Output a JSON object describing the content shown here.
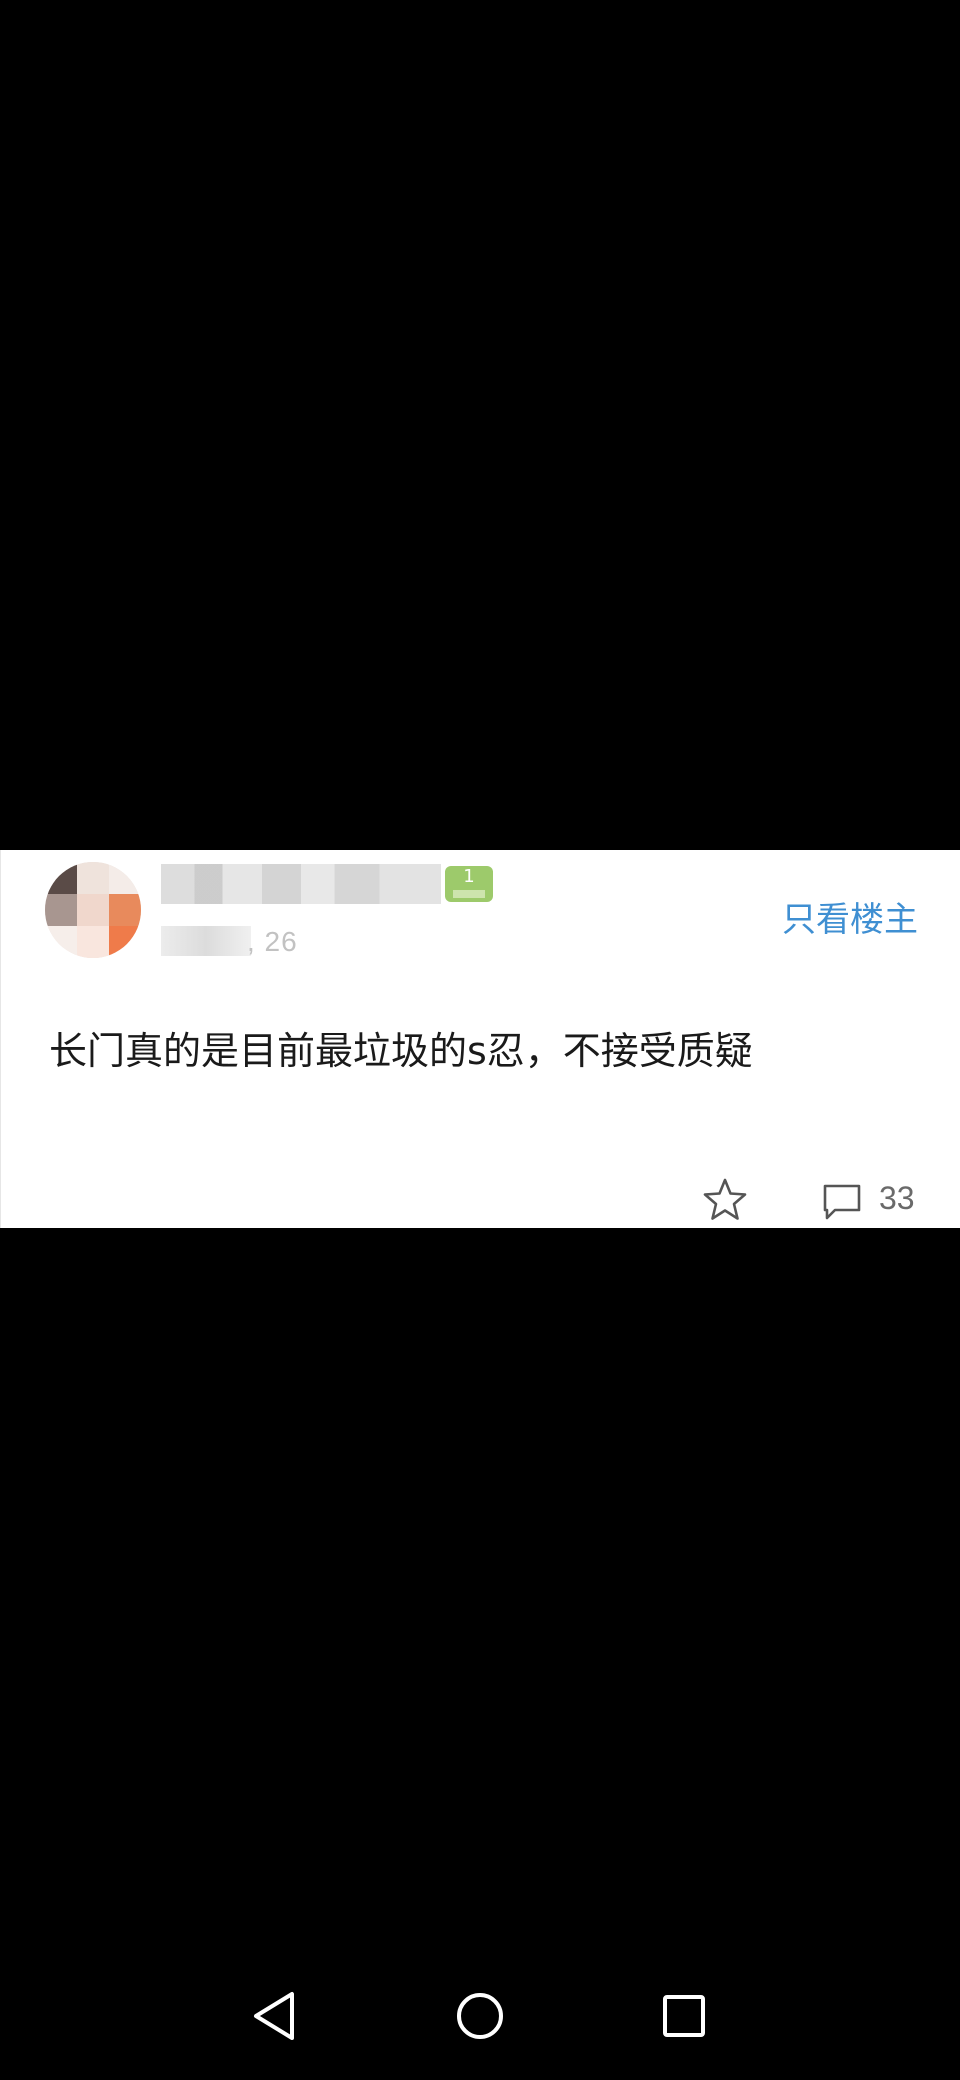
{
  "post": {
    "only_op_label": "只看楼主",
    "meta_partial": ", 26",
    "level_badge": "1",
    "content": "长门真的是目前最垃圾的s忍，不接受质疑",
    "comment_count": "33"
  },
  "icons": {
    "star": "star-icon",
    "comment": "comment-icon",
    "back": "back-triangle-icon",
    "home": "home-circle-icon",
    "recent": "recent-square-icon"
  },
  "colors": {
    "accent": "#3f8fd2",
    "level_badge": "#8cc152",
    "background": "#000000",
    "card": "#ffffff"
  }
}
